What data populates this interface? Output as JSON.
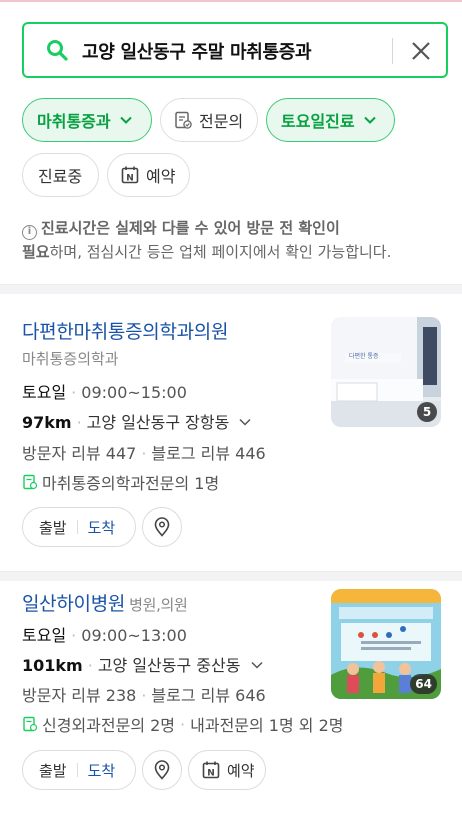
{
  "search": {
    "query": "고양 일산동구 주말 마취통증과",
    "clear_icon": "close-icon",
    "search_icon": "search-icon"
  },
  "filters": {
    "department": "마취통증과",
    "specialist": "전문의",
    "saturday": "토요일진료",
    "open_now": "진료중",
    "reservation": "예약"
  },
  "notice": {
    "bold_1": "진료시간은 실제와 다를 수 있어 방문 전 확인이",
    "bold_2": "필요",
    "rest_2": "하며, 점심시간 등은 업체 페이지에서 확인 가능합니다."
  },
  "results": [
    {
      "name": "다편한마취통증의학과의원",
      "category": "마취통증의학과",
      "day": "토요일",
      "hours": "09:00~15:00",
      "distance": "97km",
      "address": "고양 일산동구 장항동",
      "visitor_reviews": "방문자 리뷰 447",
      "blog_reviews": "블로그 리뷰 446",
      "specialist": "마취통증의학과전문의 1명",
      "photo_count": "5",
      "depart_label": "출발",
      "arrive_label": "도착"
    },
    {
      "name": "일산하이병원",
      "category": "병원,의원",
      "day": "토요일",
      "hours": "09:00~13:00",
      "distance": "101km",
      "address": "고양 일산동구 중산동",
      "visitor_reviews": "방문자 리뷰 238",
      "blog_reviews": "블로그 리뷰 646",
      "specialist": "신경외과전문의 2명",
      "specialist_extra": "내과전문의 1명 외 2명",
      "photo_count": "64",
      "depart_label": "출발",
      "arrive_label": "도착",
      "reserve_label": "예약"
    }
  ],
  "colors": {
    "accent_green": "#19ce60",
    "link_blue": "#1a53a8"
  }
}
